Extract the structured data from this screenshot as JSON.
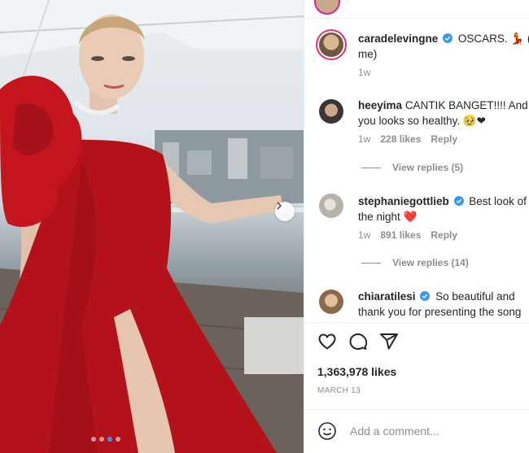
{
  "post": {
    "author": "caradelevingne",
    "caption": "OSCARS. 💃 (",
    "caption_line2": "me)",
    "caption_age": "1w",
    "likes": "1,363,978 likes",
    "date": "MARCH 13",
    "carousel_pages": 4,
    "carousel_active": 2
  },
  "comments": [
    {
      "username": "heeyima",
      "verified": false,
      "text_line1": "CANTIK BANGET!!!! And",
      "text_line2": "you looks so healthy. 🥹❤",
      "age": "1w",
      "likes": "228 likes",
      "reply": "Reply",
      "view_replies": "View replies (5)"
    },
    {
      "username": "stephaniegottlieb",
      "verified": true,
      "text_line1": "Best look of",
      "text_line2": "the night ❤️",
      "age": "1w",
      "likes": "891 likes",
      "reply": "Reply",
      "view_replies": "View replies (14)"
    },
    {
      "username": "chiaratilesi",
      "verified": true,
      "text_line1": "So beautiful and",
      "text_line2": "thank you for presenting the song"
    }
  ],
  "comment_input": {
    "placeholder": "Add a comment..."
  },
  "icons": [
    "heart-icon",
    "comment-icon",
    "share-icon",
    "emoji-icon",
    "verified-icon",
    "chevron-right-icon"
  ],
  "colors": {
    "verified": "#3897f0",
    "story_ring": "#e1306c",
    "dress": "#b3121b"
  }
}
